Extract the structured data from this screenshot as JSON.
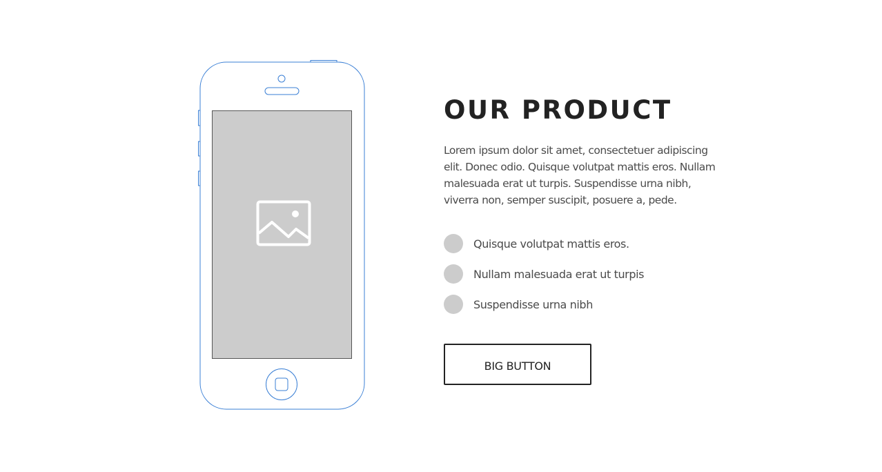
{
  "section": {
    "title": "OUR PRODUCT",
    "description": "Lorem ipsum dolor sit amet, consectetuer adipiscing elit. Donec odio. Quisque volutpat mattis eros. Nullam malesuada erat ut turpis. Suspendisse urna nibh, viverra non, semper suscipit, posuere a, pede.",
    "features": [
      {
        "label": "Quisque volutpat mattis eros."
      },
      {
        "label": "Nullam malesuada erat ut turpis"
      },
      {
        "label": "Suspendisse urna nibh"
      }
    ],
    "button_label": "BIG BUTTON"
  },
  "phone": {
    "screen_icon": "image-placeholder-icon"
  },
  "colors": {
    "phone_outline": "#3a7fd5",
    "screen_fill": "#cccccc",
    "bullet": "#cccccc",
    "title_text": "#222222",
    "body_text": "#4a4a4a"
  }
}
